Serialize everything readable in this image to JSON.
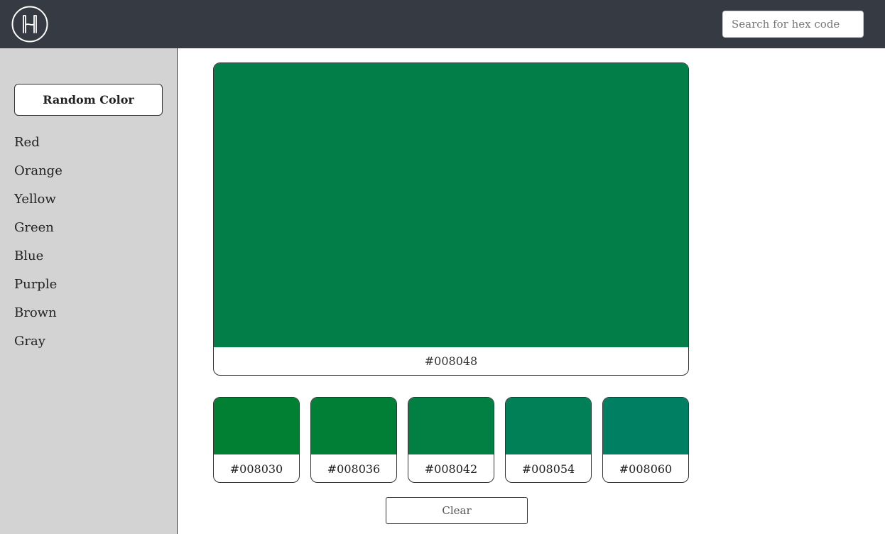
{
  "header": {
    "logo_icon": "h-monogram-logo-icon",
    "search": {
      "placeholder": "Search for hex code",
      "value": ""
    }
  },
  "sidebar": {
    "random_button_label": "Random Color",
    "items": [
      {
        "label": "Red"
      },
      {
        "label": "Orange"
      },
      {
        "label": "Yellow"
      },
      {
        "label": "Green"
      },
      {
        "label": "Blue"
      },
      {
        "label": "Purple"
      },
      {
        "label": "Brown"
      },
      {
        "label": "Gray"
      }
    ]
  },
  "main": {
    "selected": {
      "hex_label": "#008048",
      "color": "#027f48"
    },
    "shades": [
      {
        "hex_label": "#008030",
        "color": "#017f32"
      },
      {
        "hex_label": "#008036",
        "color": "#017f37"
      },
      {
        "hex_label": "#008042",
        "color": "#027f42"
      },
      {
        "hex_label": "#008054",
        "color": "#017f56"
      },
      {
        "hex_label": "#008060",
        "color": "#017f63"
      }
    ],
    "clear_button_label": "Clear"
  },
  "colors": {
    "topbar": "#363a43",
    "sidebar": "#d3d3d3"
  }
}
